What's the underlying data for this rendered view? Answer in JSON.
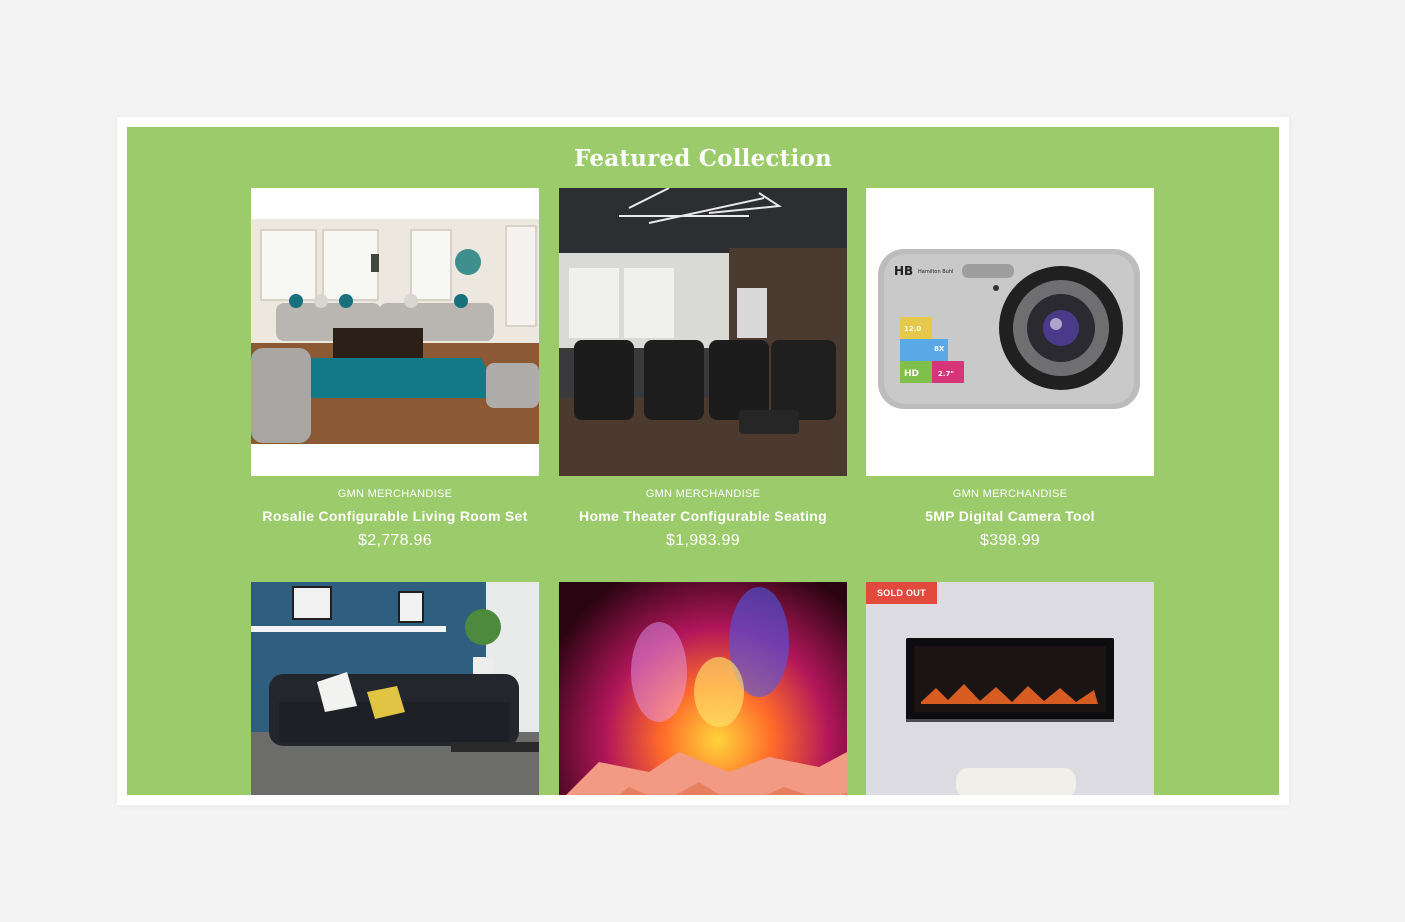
{
  "section": {
    "title": "Featured Collection",
    "background": "#9bcb6a"
  },
  "products": [
    {
      "vendor": "GMN MERCHANDISE",
      "name": "Rosalie Configurable Living Room Set",
      "price": "$2,778.96",
      "image": "living-room-sofa-set-image"
    },
    {
      "vendor": "GMN MERCHANDISE",
      "name": "Home Theater Configurable Seating",
      "price": "$1,983.99",
      "image": "home-theater-recliners-image"
    },
    {
      "vendor": "GMN MERCHANDISE",
      "name": "5MP Digital Camera Tool",
      "price": "$398.99",
      "image": "digital-camera-image",
      "camera_brand": "Hamilton Buhl",
      "camera_stickers": [
        "12.0",
        "8X",
        "HD",
        "2.7\""
      ]
    },
    {
      "image": "black-sofa-image"
    },
    {
      "image": "fireplace-flames-image"
    },
    {
      "image": "wall-fireplace-image",
      "badge": "SOLD OUT",
      "badge_color": "#e14a3c"
    }
  ]
}
